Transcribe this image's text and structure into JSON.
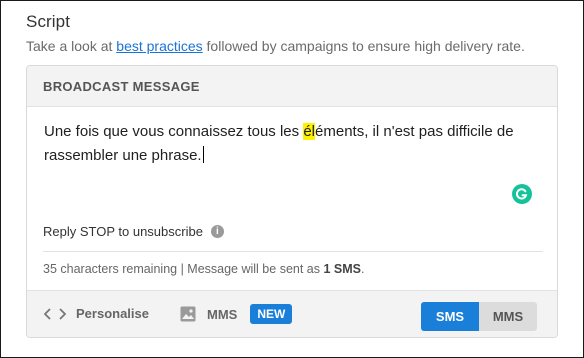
{
  "section": {
    "title": "Script",
    "subtitle_prefix": "Take a look at ",
    "subtitle_link": "best practices",
    "subtitle_suffix": " followed by campaigns to ensure high delivery rate."
  },
  "card": {
    "header": "BROADCAST MESSAGE",
    "message_before": "Une fois que vous connaissez tous les ",
    "message_highlight": "él",
    "message_after_line1": "éments, il n'est pas difficile de",
    "message_line2": "rassembler une phrase.",
    "reply_text": "Reply STOP to unsubscribe",
    "remaining_text": "35 characters remaining | Message will be sent as ",
    "remaining_count": "1 SMS",
    "remaining_end": "."
  },
  "footer": {
    "personalise_label": "Personalise",
    "mms_label": "MMS",
    "new_badge": "NEW",
    "toggle_sms": "SMS",
    "toggle_mms": "MMS"
  },
  "colors": {
    "accent": "#1a7fd8",
    "link": "#1a73d6",
    "highlight": "#fff200",
    "grammarly": "#15c39a"
  },
  "icons": {
    "code": "code-icon",
    "image": "image-icon",
    "info": "info-icon",
    "grammarly": "grammarly-icon"
  }
}
